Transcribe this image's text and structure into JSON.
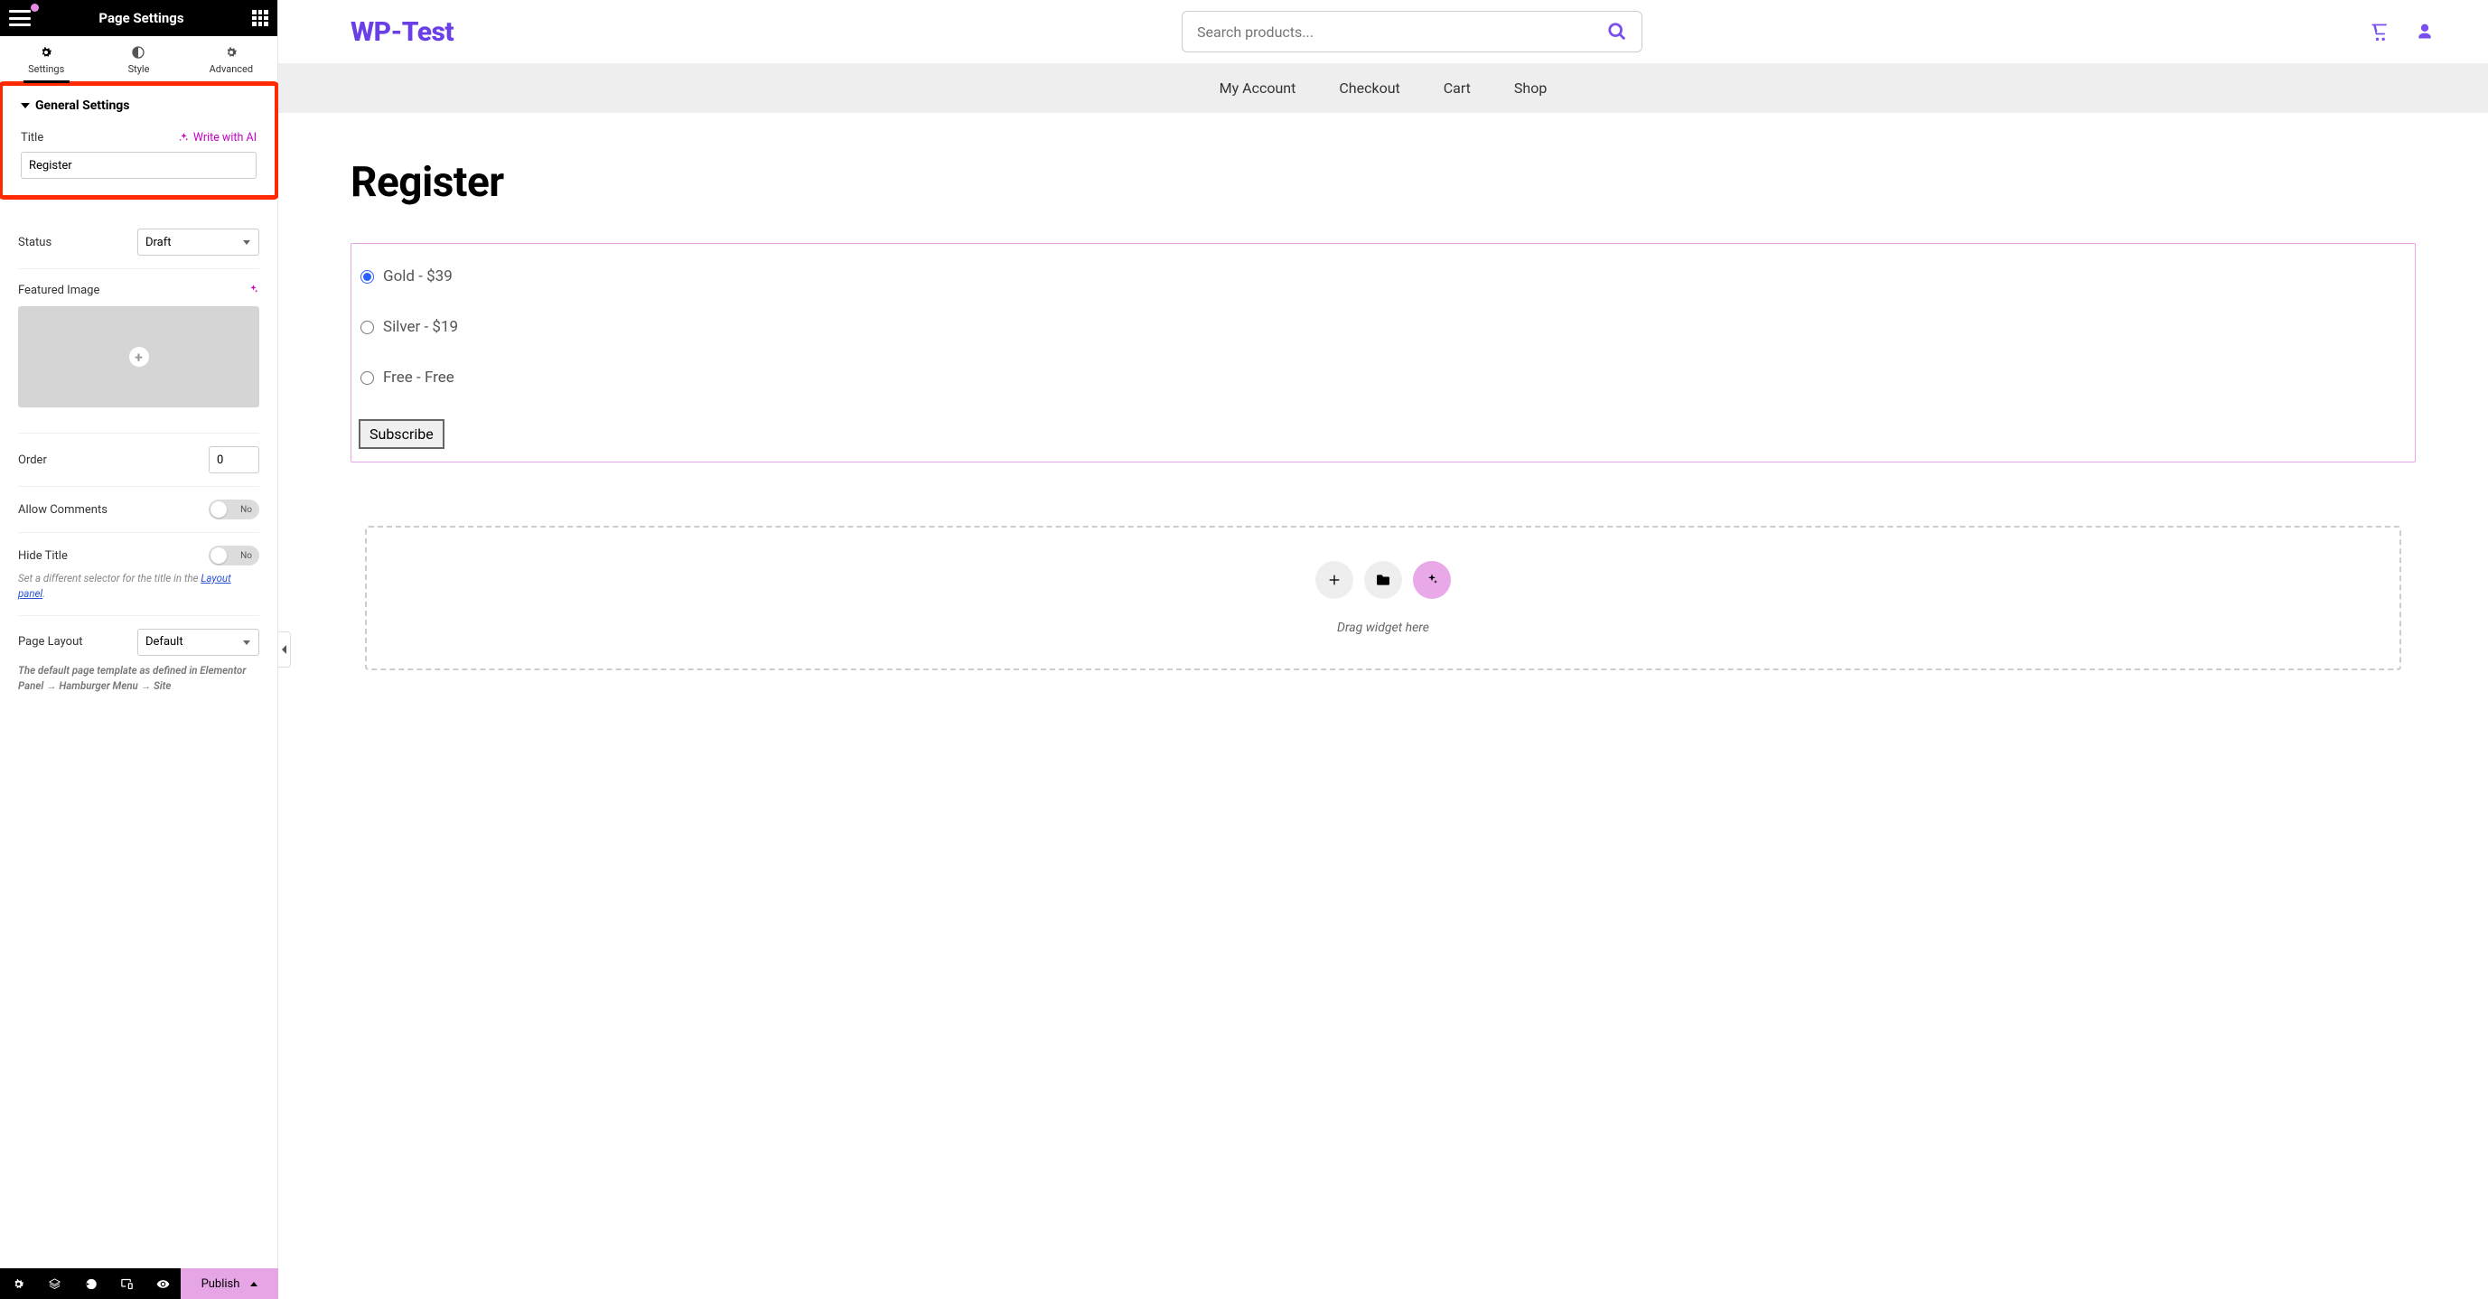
{
  "sidebar": {
    "header_title": "Page Settings",
    "tabs": {
      "settings": "Settings",
      "style": "Style",
      "advanced": "Advanced"
    },
    "section_heading": "General Settings",
    "title_label": "Title",
    "ai_link": "Write with AI",
    "title_value": "Register",
    "status_label": "Status",
    "status_value": "Draft",
    "featured_label": "Featured Image",
    "order_label": "Order",
    "order_value": "0",
    "allow_comments_label": "Allow Comments",
    "hide_title_label": "Hide Title",
    "toggle_no": "No",
    "hint_selector_pre": "Set a different selector for the title in the ",
    "hint_selector_link": "Layout panel",
    "hint_selector_post": ".",
    "page_layout_label": "Page Layout",
    "page_layout_value": "Default",
    "hint_layout": "The default page template as defined in Elementor Panel → Hamburger Menu → Site",
    "publish_label": "Publish"
  },
  "site": {
    "logo": "WP-Test",
    "search_placeholder": "Search products...",
    "nav": {
      "account": "My Account",
      "checkout": "Checkout",
      "cart": "Cart",
      "shop": "Shop"
    }
  },
  "page": {
    "title": "Register",
    "plans": {
      "gold": "Gold - $39",
      "silver": "Silver - $19",
      "free": "Free - Free"
    },
    "subscribe": "Subscribe",
    "drop_hint": "Drag widget here"
  }
}
